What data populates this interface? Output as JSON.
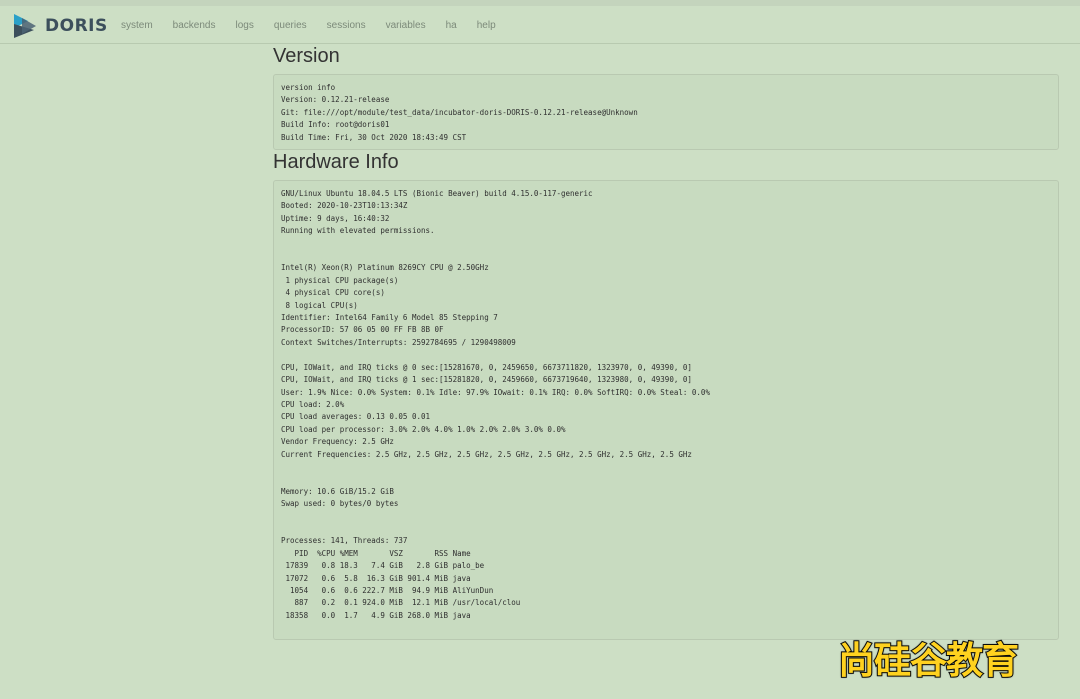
{
  "navbar": {
    "brand": "DORIS",
    "items": [
      "system",
      "backends",
      "logs",
      "queries",
      "sessions",
      "variables",
      "ha",
      "help"
    ]
  },
  "version": {
    "title": "Version",
    "text": "version info\nVersion: 0.12.21-release\nGit: file:///opt/module/test_data/incubator-doris-DORIS-0.12.21-release@Unknown\nBuild Info: root@doris01\nBuild Time: Fri, 30 Oct 2020 18:43:49 CST"
  },
  "hardware": {
    "title": "Hardware Info",
    "text": "GNU/Linux Ubuntu 18.04.5 LTS (Bionic Beaver) build 4.15.0-117-generic\nBooted: 2020-10-23T10:13:34Z\nUptime: 9 days, 16:40:32\nRunning with elevated permissions.\n\n\nIntel(R) Xeon(R) Platinum 8269CY CPU @ 2.50GHz\n 1 physical CPU package(s)\n 4 physical CPU core(s)\n 8 logical CPU(s)\nIdentifier: Intel64 Family 6 Model 85 Stepping 7\nProcessorID: 57 06 05 00 FF FB 8B 0F\nContext Switches/Interrupts: 2592784695 / 1290498009\n\nCPU, IOWait, and IRQ ticks @ 0 sec:[15281670, 0, 2459650, 6673711820, 1323970, 0, 49390, 0]\nCPU, IOWait, and IRQ ticks @ 1 sec:[15281820, 0, 2459660, 6673719640, 1323980, 0, 49390, 0]\nUser: 1.9% Nice: 0.0% System: 0.1% Idle: 97.9% IOwait: 0.1% IRQ: 0.0% SoftIRQ: 0.0% Steal: 0.0%\nCPU load: 2.0%\nCPU load averages: 0.13 0.05 0.01\nCPU load per processor: 3.0% 2.0% 4.0% 1.0% 2.0% 2.0% 3.0% 0.0%\nVendor Frequency: 2.5 GHz\nCurrent Frequencies: 2.5 GHz, 2.5 GHz, 2.5 GHz, 2.5 GHz, 2.5 GHz, 2.5 GHz, 2.5 GHz, 2.5 GHz\n\n\nMemory: 10.6 GiB/15.2 GiB\nSwap used: 0 bytes/0 bytes\n\n\nProcesses: 141, Threads: 737\n   PID  %CPU %MEM       VSZ       RSS Name\n 17839   0.8 18.3   7.4 GiB   2.8 GiB palo_be\n 17072   0.6  5.8  16.3 GiB 901.4 MiB java\n  1054   0.6  0.6 222.7 MiB  94.9 MiB AliYunDun\n   887   0.2  0.1 924.0 MiB  12.1 MiB /usr/local/clou\n 18358   0.0  1.7   4.9 GiB 268.0 MiB java"
  },
  "watermark": "尚硅谷教育",
  "colors": {
    "background": "#cddfc5",
    "panel": "#c8dbc0",
    "logo_dark": "#3c4f5c",
    "logo_accent": "#2aa0c8",
    "watermark": "#ffd21f"
  }
}
